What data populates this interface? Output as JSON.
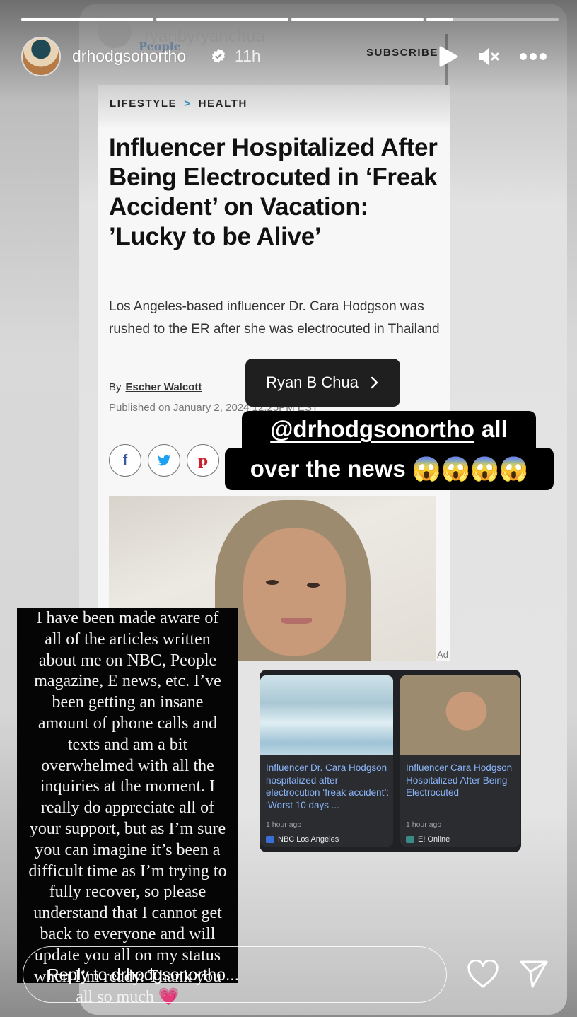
{
  "story": {
    "progress": {
      "segments": 4,
      "current_segment": 4,
      "segment_fill": [
        1,
        1,
        1,
        0.2
      ]
    },
    "header": {
      "username": "drhodgsonortho",
      "verified": true,
      "time_ago": "11h",
      "icons": [
        "play-icon",
        "mute-icon",
        "more-icon"
      ]
    },
    "reshared_post": {
      "faded_username": "ryanbyryanchua",
      "faded_publisher_logo": "People",
      "subscribe_label": "SUBSCRIBE"
    },
    "article": {
      "breadcrumb": [
        "LIFESTYLE",
        "HEALTH"
      ],
      "breadcrumb_separator": ">",
      "headline": "Influencer Hospitalized After Being Electrocuted in ‘Freak Accident’ on Vacation: ’Lucky to be Alive’",
      "dek": "Los Angeles-based influencer Dr. Cara Hodgson was rushed to the ER after she was electrocuted in Thailand",
      "byline_prefix": "By",
      "author": "Escher Walcott",
      "published": "Published on January 2, 2024 12:25PM EST",
      "share_buttons": [
        "f",
        "t",
        "p"
      ],
      "ad_label": "Ad"
    },
    "mention_tag": {
      "label": "Ryan B Chua",
      "chevron": "›"
    },
    "caption": {
      "mention": "@drhodgsonortho",
      "line1_rest": "all",
      "line2": "over the news 😱😱😱😱"
    },
    "statement": {
      "lines": [
        "I have been made aware of",
        "all of the articles written",
        "about me on NBC, People",
        "magazine, E news, etc. I’ve",
        "been getting an insane",
        "amount of phone calls and",
        "texts and am a bit",
        "overwhelmed with all the",
        "inquiries at the moment. I",
        "really do appreciate all of",
        "your support, but as I’m sure",
        "you can imagine it’s been a",
        "difficult time as I’m trying to",
        "fully recover, so please",
        "understand that I cannot get",
        "back to everyone and will",
        "update you all on my status",
        "when I’m ready.  Thank you",
        "all so much 💗"
      ]
    },
    "news_cards": [
      {
        "title": "Influencer Dr. Cara Hodgson hospitalized after electrocution ‘freak accident’: ‘Worst 10 days ...",
        "time_ago": "1 hour ago",
        "source": "NBC Los Angeles",
        "accent": "#3a6fd8"
      },
      {
        "title": "Influencer Cara Hodgson Hospitalized After Being Electrocuted",
        "time_ago": "1 hour ago",
        "source": "E! Online",
        "accent": "#3b8a8a"
      }
    ],
    "footer": {
      "reply_placeholder": "Reply to drhodgsonortho...",
      "icons": [
        "heart-icon",
        "send-icon"
      ]
    },
    "colors": {
      "link_blue": "#8ab4f8",
      "breadcrumb_chevron": "#2b8ab8",
      "tag_bg": "#1f1f1f"
    }
  }
}
